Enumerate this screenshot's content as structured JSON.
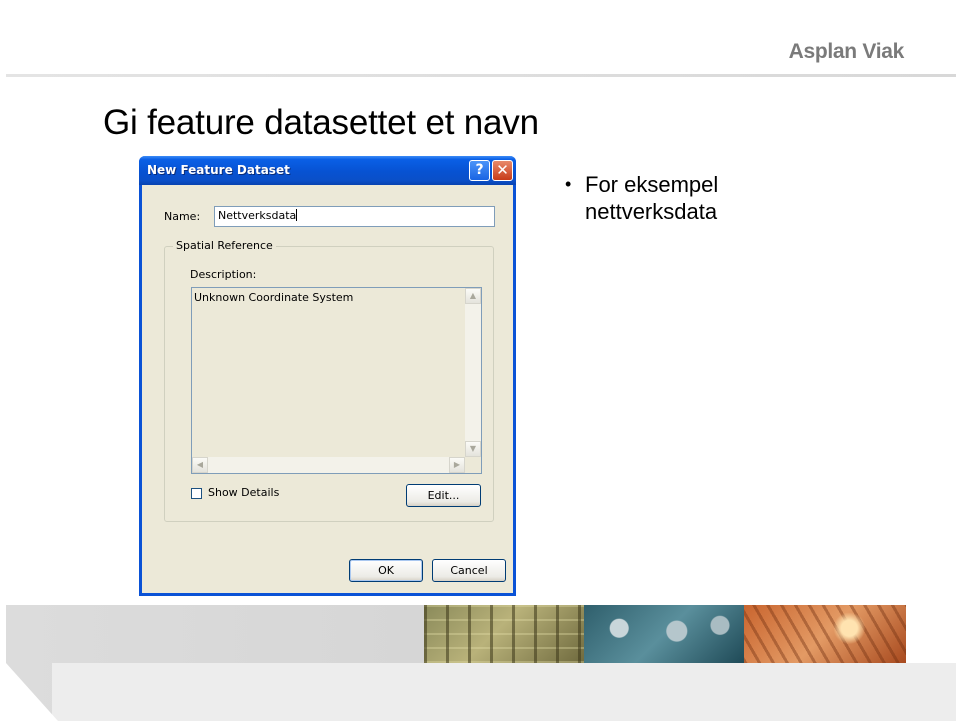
{
  "brand": "Asplan Viak",
  "slide": {
    "title": "Gi feature datasettet et navn",
    "bullets": [
      "For eksempel nettverksdata"
    ]
  },
  "dialog": {
    "title": "New Feature Dataset",
    "help_icon": "help-icon",
    "close_icon": "close-icon",
    "name_label": "Name:",
    "name_value": "Nettverksdata",
    "spatial_reference_legend": "Spatial Reference",
    "description_label": "Description:",
    "description_value": "Unknown Coordinate System",
    "show_details_label": "Show Details",
    "show_details_checked": false,
    "edit_button": "Edit...",
    "ok_button": "OK",
    "cancel_button": "Cancel"
  },
  "colors": {
    "titlebar": "#0752d2",
    "dialog_bg": "#ece9d8",
    "brand_text": "#7a7a7a"
  }
}
